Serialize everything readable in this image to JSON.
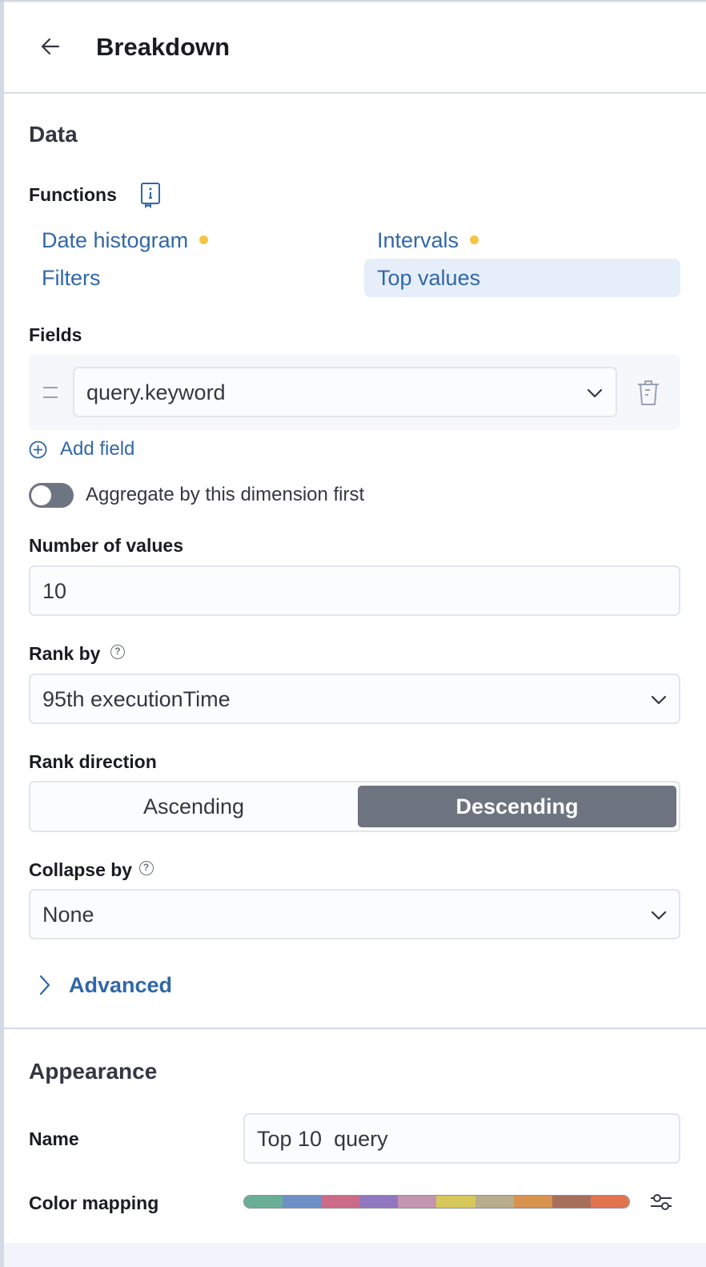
{
  "header": {
    "title": "Breakdown"
  },
  "data_section": {
    "title": "Data",
    "functions_label": "Functions",
    "functions": [
      {
        "label": "Date histogram",
        "compatible": true
      },
      {
        "label": "Intervals",
        "compatible": true
      },
      {
        "label": "Filters",
        "compatible": false
      },
      {
        "label": "Top values",
        "selected": true
      }
    ],
    "fields_label": "Fields",
    "field_value": "query.keyword",
    "add_field_label": "Add field",
    "aggregate_toggle_label": "Aggregate by this dimension first",
    "aggregate_toggle_on": false,
    "number_of_values_label": "Number of values",
    "number_of_values": "10",
    "rank_by_label": "Rank by",
    "rank_by_value": "95th executionTime",
    "rank_direction_label": "Rank direction",
    "rank_direction_options": [
      "Ascending",
      "Descending"
    ],
    "rank_direction_selected": "Descending",
    "collapse_by_label": "Collapse by",
    "collapse_by_value": "None",
    "advanced_label": "Advanced"
  },
  "appearance_section": {
    "title": "Appearance",
    "name_label": "Name",
    "name_value": "Top 10  query",
    "color_mapping_label": "Color mapping",
    "palette": [
      "#6aae96",
      "#6d91c6",
      "#cc6b87",
      "#9077bf",
      "#c594b1",
      "#d6c85a",
      "#b8ad8e",
      "#d8934f",
      "#a66f5b",
      "#e0744f"
    ]
  },
  "colors": {
    "accent": "#3167a8",
    "selected_bg": "#e6eefa",
    "indicator_dot": "#f5c542",
    "segment_selected": "#6e7380"
  },
  "icons": {
    "back": "arrow-left-icon",
    "docs": "documentation-book-icon",
    "drag": "drag-handle-icon",
    "chevron": "chevron-down-icon",
    "delete": "trash-icon",
    "add": "plus-circle-icon",
    "help": "question-icon",
    "expand": "chevron-right-icon",
    "settings": "sliders-icon"
  }
}
